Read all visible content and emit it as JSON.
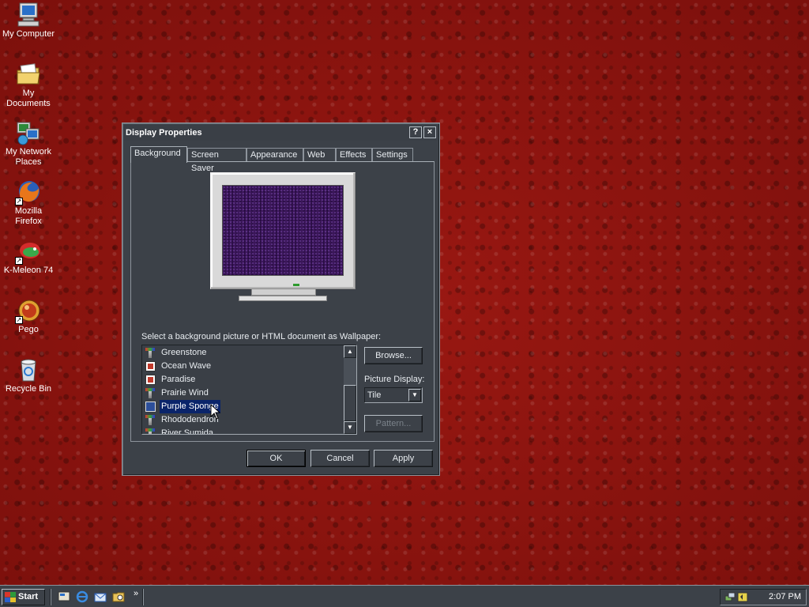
{
  "desktop": {
    "icons": [
      {
        "label": "My Computer"
      },
      {
        "label": "My Documents"
      },
      {
        "label": "My Network Places"
      },
      {
        "label": "Mozilla Firefox"
      },
      {
        "label": "K-Meleon 74"
      },
      {
        "label": "Pego"
      },
      {
        "label": "Recycle Bin"
      }
    ]
  },
  "dialog": {
    "title": "Display Properties",
    "help_label": "?",
    "close_label": "×",
    "tabs": [
      {
        "label": "Background"
      },
      {
        "label": "Screen Saver"
      },
      {
        "label": "Appearance"
      },
      {
        "label": "Web"
      },
      {
        "label": "Effects"
      },
      {
        "label": "Settings"
      }
    ],
    "active_tab": "Background",
    "prompt": "Select a background picture or HTML document as Wallpaper:",
    "wallpapers": [
      {
        "label": "Greenstone",
        "icon": "paint-icon"
      },
      {
        "label": "Ocean Wave",
        "icon": "html-document-icon"
      },
      {
        "label": "Paradise",
        "icon": "html-document-icon"
      },
      {
        "label": "Prairie Wind",
        "icon": "paint-icon"
      },
      {
        "label": "Purple Sponge",
        "icon": "bitmap-icon"
      },
      {
        "label": "Rhododendron",
        "icon": "paint-icon"
      },
      {
        "label": "River Sumida",
        "icon": "paint-icon"
      }
    ],
    "selected_wallpaper": "Purple Sponge",
    "browse_label": "Browse...",
    "picture_display_label": "Picture Display:",
    "picture_display_value": "Tile",
    "pattern_label": "Pattern...",
    "ok_label": "OK",
    "cancel_label": "Cancel",
    "apply_label": "Apply",
    "preview_color": "#3a1658"
  },
  "taskbar": {
    "start_label": "Start",
    "more_label": "»",
    "clock": "2:07 PM"
  },
  "colors": {
    "desktop_background": "#8f1410",
    "window_face": "#3c4148",
    "selection": "#0a246a"
  }
}
